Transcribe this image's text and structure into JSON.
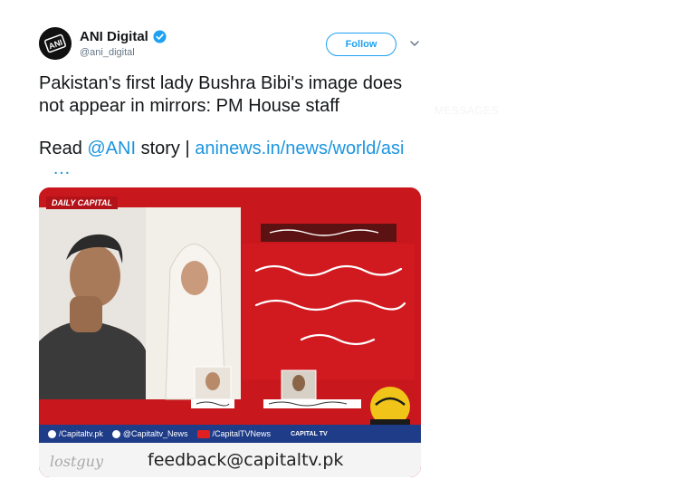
{
  "account": {
    "display_name": "ANI Digital",
    "handle": "@ani_digital",
    "avatar_text": "ANI"
  },
  "actions": {
    "follow_label": "Follow"
  },
  "tweet": {
    "line1": "Pakistan's first lady Bushra Bibi's image does",
    "line2": "not appear in mirrors: PM House staff",
    "read_prefix": "Read ",
    "mention": "@ANI",
    "read_mid": " story | ",
    "url": "aninews.in/news/world/asi",
    "ellipsis": "…"
  },
  "background": {
    "messages_label": "MESSAGES"
  },
  "media": {
    "channel_tag": "DAILY CAPITAL",
    "social": [
      "/Capitaltv.pk",
      "@Capitaltv_News",
      "/CapitalTVNews"
    ],
    "brand_label": "CAPITAL TV",
    "watermark": "lostguy",
    "feedback": "feedback@capitaltv.pk"
  },
  "colors": {
    "accent": "#1da1f2",
    "link": "#1b95e0",
    "news_red": "#c8171d",
    "news_blue": "#1f3c88"
  },
  "icons": {
    "verified": "verified-badge-icon",
    "chevron": "chevron-down-icon"
  }
}
